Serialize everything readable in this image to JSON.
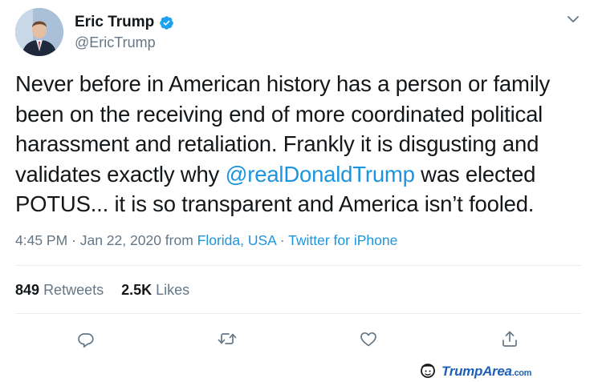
{
  "tweet": {
    "author": {
      "display_name": "Eric Trump",
      "handle": "@EricTrump",
      "verified": true
    },
    "text_parts": {
      "before_mention": "Never before in American history has a person or family been on the receiving end of more coordinated political harassment and retaliation. Frankly it is disgusting and validates exactly why ",
      "mention": "@realDonaldTrump",
      "after_mention": " was elected POTUS... it is so transparent and America isn’t fooled."
    },
    "meta": {
      "timestamp": "4:45 PM · Jan 22, 2020 from ",
      "location": "Florida, USA",
      "separator": " · ",
      "source": "Twitter for iPhone"
    },
    "stats": {
      "retweets_count": "849",
      "retweets_label": "Retweets",
      "likes_count": "2.5K",
      "likes_label": "Likes"
    },
    "actions": [
      "reply-icon",
      "retweet-icon",
      "like-icon",
      "share-icon"
    ]
  },
  "colors": {
    "link": "#1b95e0",
    "text": "#14171a",
    "secondary": "#657786",
    "divider": "#e6ecf0",
    "watermark": "#1f5fb8"
  },
  "watermark": {
    "brand": "TrumpArea",
    "suffix": ".com"
  }
}
